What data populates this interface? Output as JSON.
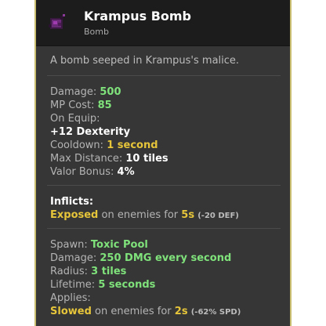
{
  "item": {
    "name": "Krampus Bomb",
    "type": "Bomb",
    "icon": "purple-bomb-icon",
    "description": "A bomb seeped in Krampus's malice."
  },
  "stats": {
    "damage_label": "Damage:",
    "damage_value": "500",
    "mp_label": "MP Cost:",
    "mp_value": "85",
    "on_equip_label": "On Equip:",
    "on_equip_value": "+12 Dexterity",
    "cooldown_label": "Cooldown:",
    "cooldown_value": "1 second",
    "max_distance_label": "Max Distance:",
    "max_distance_value": "10 tiles",
    "valor_label": "Valor Bonus:",
    "valor_value": "4%"
  },
  "inflicts": {
    "label": "Inflicts:",
    "effect": "Exposed",
    "middle": "on enemies for",
    "duration": "5s",
    "detail": "(-20 DEF)"
  },
  "spawn": {
    "spawn_label": "Spawn:",
    "spawn_value": "Toxic Pool",
    "damage_label": "Damage:",
    "damage_value": "250 DMG every second",
    "radius_label": "Radius:",
    "radius_value": "3 tiles",
    "lifetime_label": "Lifetime:",
    "lifetime_value": "5 seconds",
    "applies_label": "Applies:",
    "applies_effect": "Slowed",
    "applies_middle": "on enemies for",
    "applies_duration": "2s",
    "applies_detail": "(-62% SPD)"
  },
  "colors": {
    "border": "#c9bd70",
    "panel": "#363636",
    "header": "#1c1c1c",
    "green_value": "#7fe27b",
    "yellow_value": "#e6c53a"
  }
}
